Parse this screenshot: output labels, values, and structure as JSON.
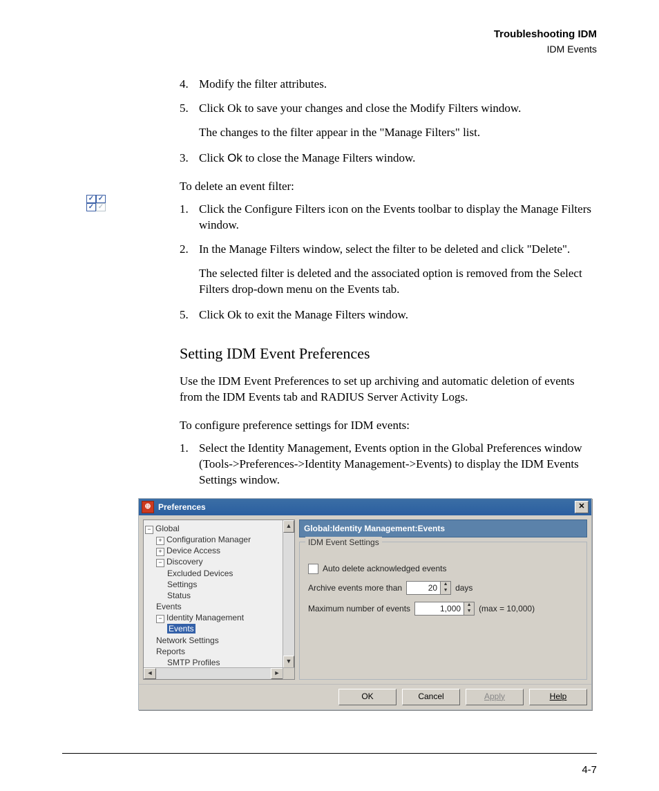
{
  "header": {
    "line1": "Troubleshooting IDM",
    "line2": "IDM Events"
  },
  "stepsA": [
    {
      "num": "4.",
      "text": "Modify the filter attributes."
    },
    {
      "num": "5.",
      "text": "Click Ok to save your changes and close the Modify Filters window."
    }
  ],
  "followA": "The changes to the filter appear in the \"Manage Filters\" list.",
  "stepsB": [
    {
      "num": "3.",
      "pre": "Click ",
      "kw": "Ok",
      "post": " to close the Manage Filters window."
    }
  ],
  "intro_delete": "To delete an event filter:",
  "stepsC": [
    {
      "num": "1.",
      "text": "Click the Configure Filters icon on the Events toolbar to display the Manage Filters window."
    },
    {
      "num": "2.",
      "text": "In the Manage Filters window, select the filter to be deleted and click \"Delete\"."
    }
  ],
  "followC": "The selected filter is deleted and the associated option is removed from the Select Filters drop-down menu on the Events tab.",
  "stepsD": [
    {
      "num": "5.",
      "text": "Click Ok to exit the Manage Filters window."
    }
  ],
  "section_heading": "Setting IDM Event Preferences",
  "section_intro": "Use the IDM Event Preferences to set up archiving and automatic deletion of events from the IDM Events tab and RADIUS Server Activity Logs.",
  "configure_intro": "To configure preference settings for IDM events:",
  "stepsE": [
    {
      "num": "1.",
      "text": "Select the Identity Management, Events option in the Global Preferences window (Tools->Preferences->Identity Management->Events) to display the IDM Events Settings window."
    }
  ],
  "dialog": {
    "title": "Preferences",
    "tree": {
      "root": "Global",
      "items": [
        {
          "label": "Configuration Manager",
          "exp": "+",
          "indent": 1
        },
        {
          "label": "Device Access",
          "exp": "+",
          "indent": 1
        },
        {
          "label": "Discovery",
          "exp": "−",
          "indent": 1
        },
        {
          "label": "Excluded Devices",
          "indent": 2
        },
        {
          "label": "Settings",
          "indent": 2
        },
        {
          "label": "Status",
          "indent": 2
        },
        {
          "label": "Events",
          "indent": 1
        },
        {
          "label": "Identity Management",
          "exp": "−",
          "indent": 1
        },
        {
          "label": "Events",
          "indent": 2,
          "selected": true
        },
        {
          "label": "Network Settings",
          "indent": 1
        },
        {
          "label": "Reports",
          "indent": 1
        },
        {
          "label": "SMTP Profiles",
          "indent": 2
        }
      ]
    },
    "panel_title": "Global:Identity Management:Events",
    "group_legend": "IDM Event Settings",
    "check_label": "Auto delete acknowledged events",
    "archive_label_pre": "Archive events more than",
    "archive_value": "20",
    "archive_label_post": "days",
    "max_label": "Maximum number of events",
    "max_value": "1,000",
    "max_suffix": "(max = 10,000)",
    "buttons": {
      "ok": "OK",
      "cancel": "Cancel",
      "apply": "Apply",
      "help": "Help"
    }
  },
  "pagenum": "4-7"
}
